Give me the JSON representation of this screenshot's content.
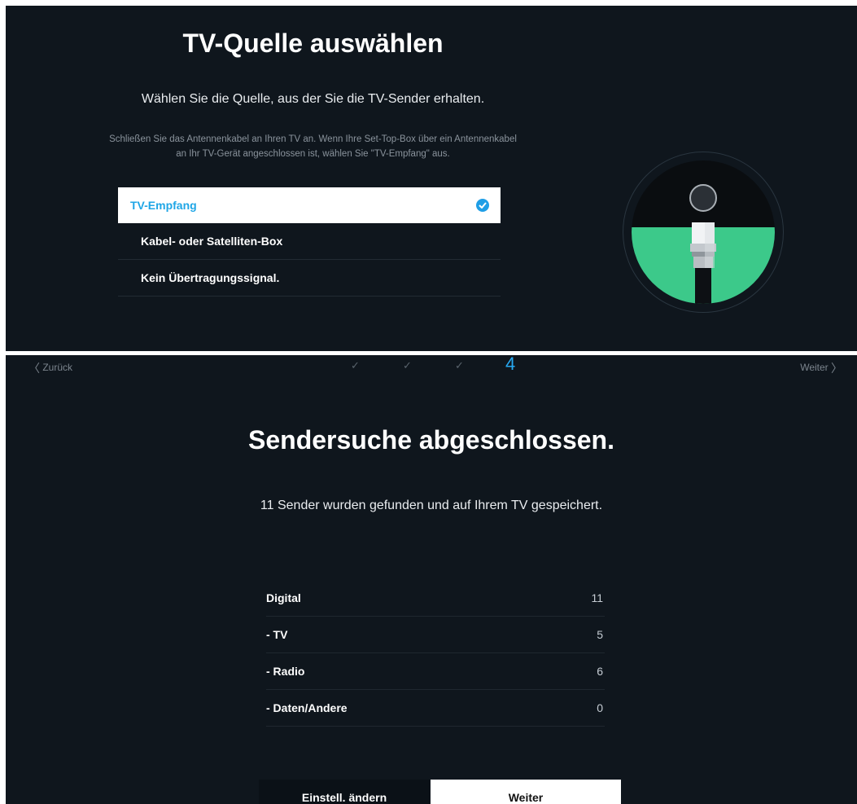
{
  "source_screen": {
    "title": "TV-Quelle auswählen",
    "subtitle": "Wählen Sie die Quelle, aus der Sie die TV-Sender erhalten.",
    "hint": "Schließen Sie das Antennenkabel an Ihren TV an. Wenn Ihre Set-Top-Box über ein Antennenkabel an Ihr TV-Gerät angeschlossen ist, wählen Sie \"TV-Empfang\" aus.",
    "options": [
      {
        "label": "TV-Empfang",
        "selected": true
      },
      {
        "label": "Kabel- oder Satelliten-Box",
        "selected": false
      },
      {
        "label": "Kein Übertragungssignal.",
        "selected": false
      }
    ],
    "colors": {
      "accent": "#1fa6e6",
      "illustration_green": "#3cc98a"
    }
  },
  "result_screen": {
    "nav": {
      "back_label": "Zurück",
      "next_label": "Weiter",
      "completed_steps": [
        "✓",
        "✓",
        "✓"
      ],
      "current_step": "4"
    },
    "title": "Sendersuche abgeschlossen.",
    "subtitle": "11 Sender wurden gefunden und auf Ihrem TV gespeichert.",
    "results": [
      {
        "label": "Digital",
        "value": "11"
      },
      {
        "label": "- TV",
        "value": "5"
      },
      {
        "label": "- Radio",
        "value": "6"
      },
      {
        "label": "- Daten/Andere",
        "value": "0"
      }
    ],
    "buttons": {
      "change_settings": "Einstell. ändern",
      "next": "Weiter"
    }
  }
}
